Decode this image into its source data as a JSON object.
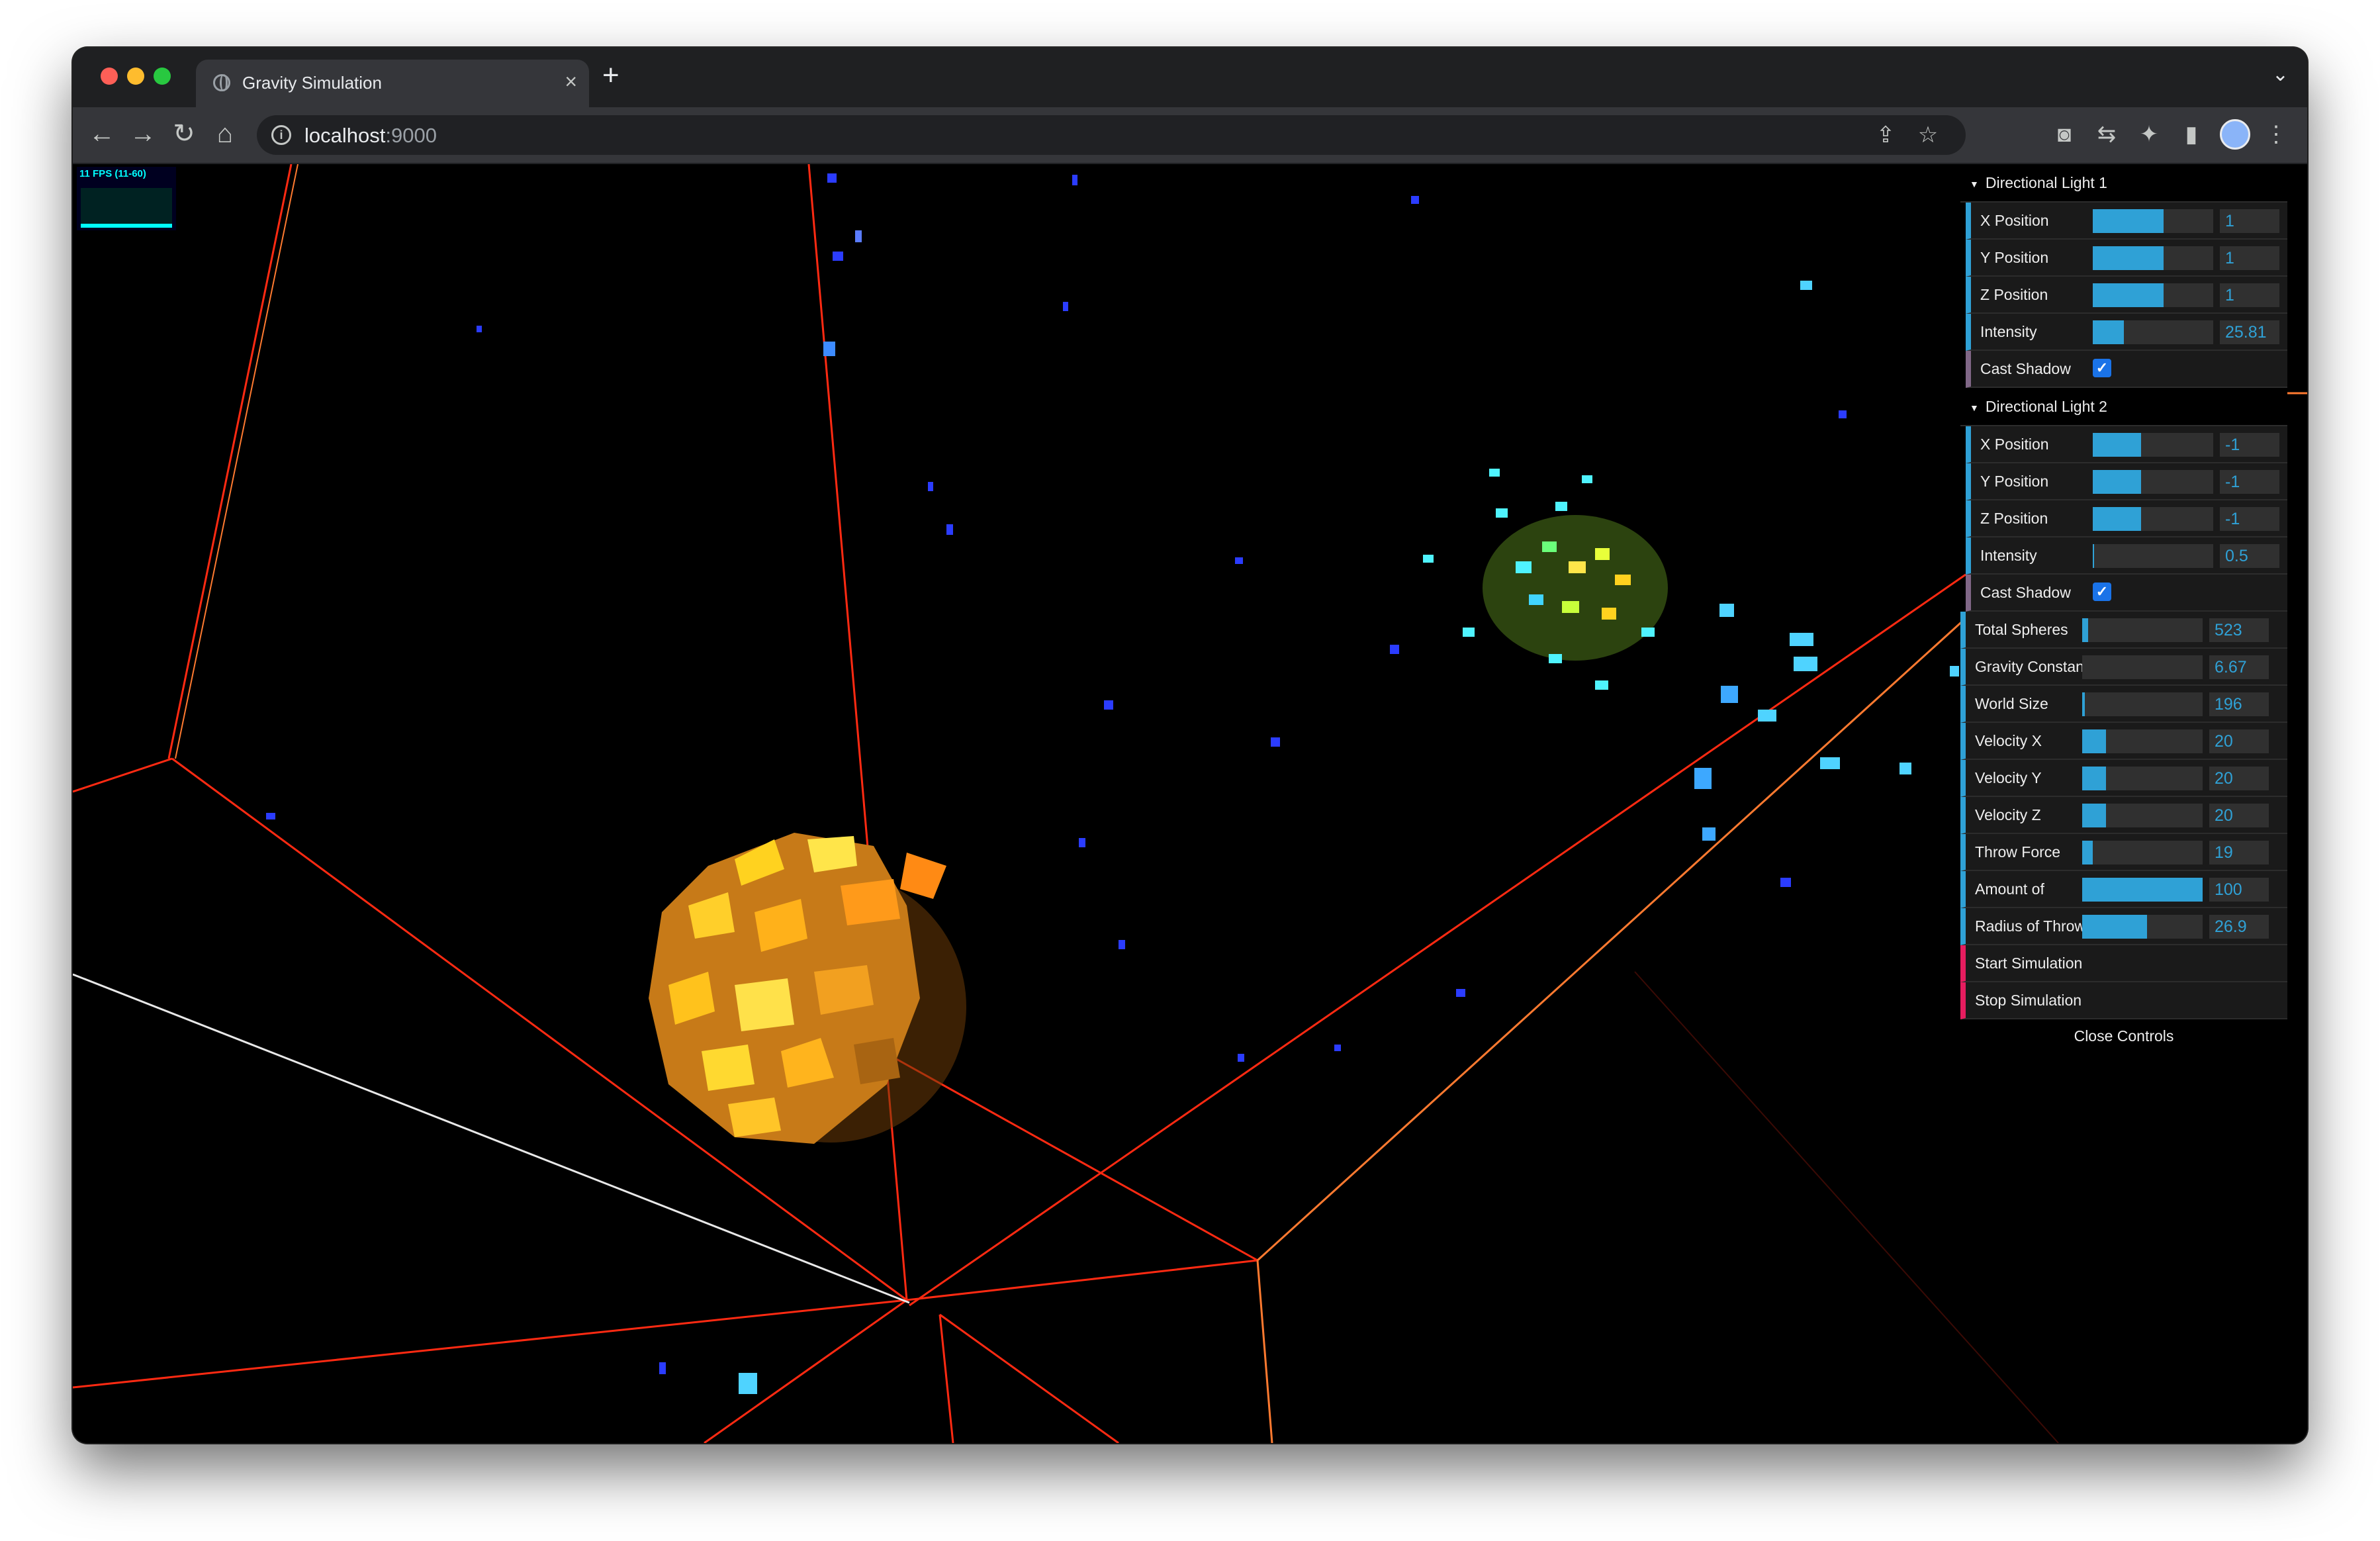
{
  "window": {
    "tab_title": "Gravity Simulation",
    "tab_close": "×",
    "new_tab": "+",
    "tab_list": "⌄",
    "url_host": "localhost",
    "url_port": ":9000",
    "info": "i"
  },
  "toolbar": {
    "back": "←",
    "forward": "→",
    "reload": "↻",
    "home": "⌂",
    "share": "⇪",
    "bookmark": "☆",
    "screenshot": "◙",
    "translate": "⇆",
    "extensions": "✦",
    "sidepanel": "▮",
    "menu": "⋮"
  },
  "stats": {
    "fps_text": "11 FPS (11-60)"
  },
  "gui": {
    "light1": {
      "title": "Directional Light 1",
      "rows": [
        {
          "label": "X Position",
          "value": "1",
          "fill": 0.59
        },
        {
          "label": "Y Position",
          "value": "1",
          "fill": 0.59
        },
        {
          "label": "Z Position",
          "value": "1",
          "fill": 0.59
        },
        {
          "label": "Intensity",
          "value": "25.81",
          "fill": 0.26
        }
      ],
      "shadow_label": "Cast Shadow",
      "shadow_check": "✓"
    },
    "light2": {
      "title": "Directional Light 2",
      "rows": [
        {
          "label": "X Position",
          "value": "-1",
          "fill": 0.4
        },
        {
          "label": "Y Position",
          "value": "-1",
          "fill": 0.4
        },
        {
          "label": "Z Position",
          "value": "-1",
          "fill": 0.4
        },
        {
          "label": "Intensity",
          "value": "0.5",
          "fill": 0.01
        }
      ],
      "shadow_label": "Cast Shadow",
      "shadow_check": "✓"
    },
    "params": [
      {
        "label": "Total Spheres",
        "value": "523",
        "fill": 0.05
      },
      {
        "label": "Gravity Constant",
        "value": "6.67",
        "fill": 0.0
      },
      {
        "label": "World Size",
        "value": "196",
        "fill": 0.02
      },
      {
        "label": "Velocity X",
        "value": "20",
        "fill": 0.2
      },
      {
        "label": "Velocity Y",
        "value": "20",
        "fill": 0.2
      },
      {
        "label": "Velocity Z",
        "value": "20",
        "fill": 0.2
      },
      {
        "label": "Throw Force",
        "value": "19",
        "fill": 0.09
      },
      {
        "label": "Amount of",
        "value": "100",
        "fill": 1.0
      },
      {
        "label": "Radius of Throw",
        "value": "26.9",
        "fill": 0.54
      }
    ],
    "actions": [
      {
        "label": "Start Simulation"
      },
      {
        "label": "Stop Simulation"
      }
    ],
    "close_label": "Close Controls"
  },
  "colors": {
    "slider_fill": "#2fa1d6",
    "grid_line": "#ff2a12",
    "cluster_warm": "#ffd21f",
    "cluster_cool": "#4ff3ff",
    "particle_blue": "#2b3cff"
  }
}
